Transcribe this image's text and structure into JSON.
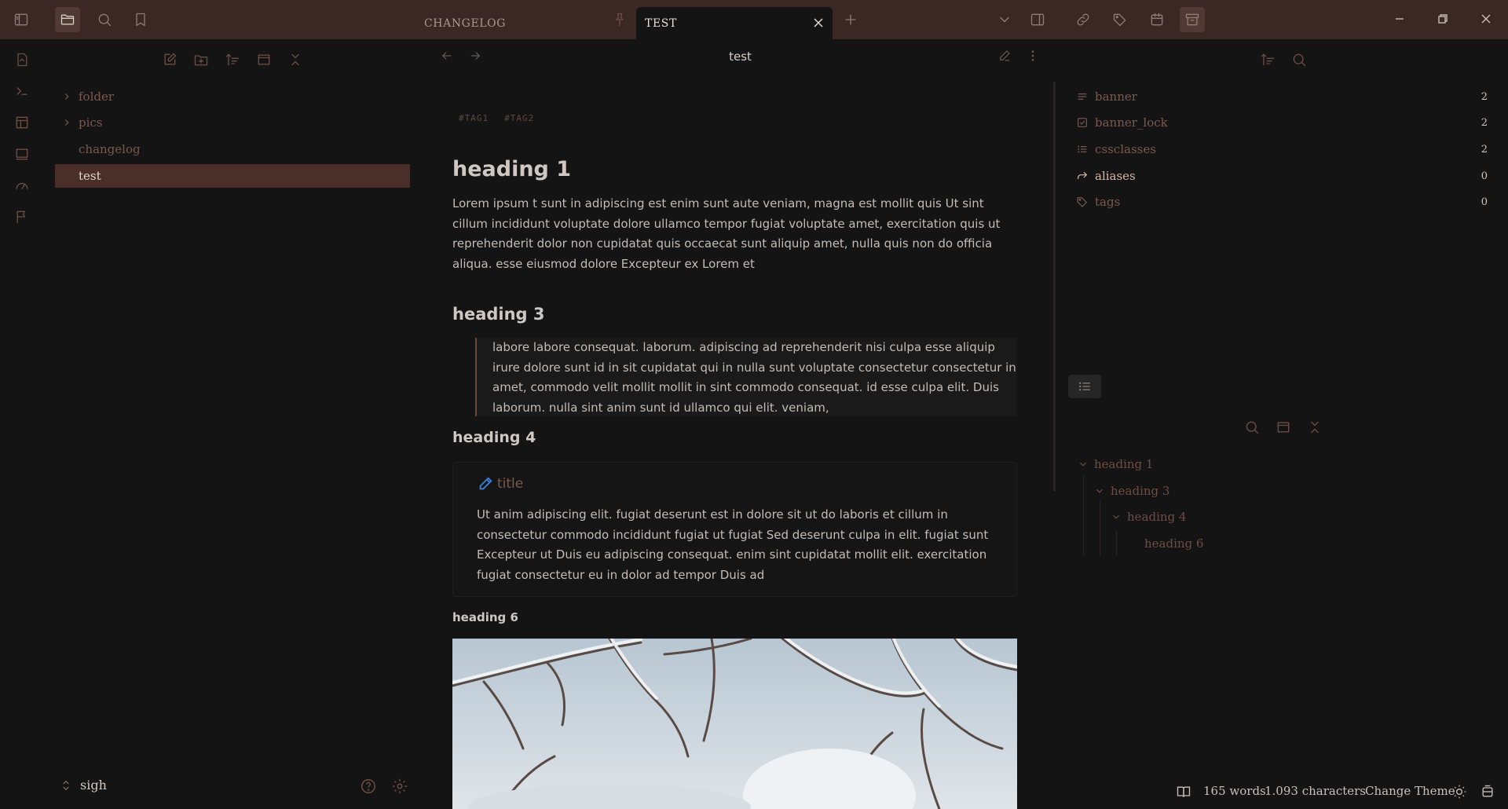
{
  "tabs": [
    {
      "label": "CHANGELOG",
      "active": false
    },
    {
      "label": "TEST",
      "active": true
    }
  ],
  "file_explorer": {
    "items": [
      {
        "label": "folder",
        "type": "folder"
      },
      {
        "label": "pics",
        "type": "folder"
      },
      {
        "label": "changelog",
        "type": "file"
      },
      {
        "label": "test",
        "type": "file",
        "selected": true
      }
    ],
    "vault_name": "sigh"
  },
  "editor": {
    "title": "test",
    "tags": [
      "#TAG1",
      "#TAG2"
    ],
    "heading1": "heading 1",
    "para1": "Lorem ipsum t sunt in adipiscing est enim sunt aute veniam, magna est mollit quis Ut sint cillum incididunt voluptate dolore ullamco tempor fugiat voluptate amet, exercitation quis ut reprehenderit dolor non cupidatat quis occaecat sunt aliquip amet, nulla quis non do officia aliqua. esse eiusmod dolore Excepteur ex Lorem et",
    "heading3": "heading 3",
    "quote": "labore labore consequat. laborum. adipiscing ad reprehenderit nisi culpa esse aliquip irure dolore sunt id in sit cupidatat qui in nulla sunt voluptate consectetur consectetur in amet, commodo velit mollit mollit in sint commodo consequat. id esse culpa elit. Duis laborum. nulla sint anim sunt id ullamco qui elit. veniam,",
    "heading4": "heading 4",
    "callout_title": "title",
    "callout_body": "Ut anim adipiscing elit. fugiat deserunt est in dolore sit ut do laboris et cillum in consectetur commodo incididunt fugiat ut fugiat Sed deserunt culpa in elit. fugiat sunt Excepteur ut Duis eu adipiscing consequat. enim sint cupidatat mollit elit. exercitation fugiat consectetur eu in dolor ad tempor Duis ad",
    "heading6": "heading 6"
  },
  "properties": [
    {
      "name": "banner",
      "icon": "text-icon",
      "count": "2"
    },
    {
      "name": "banner_lock",
      "icon": "checkbox-icon",
      "count": "2"
    },
    {
      "name": "cssclasses",
      "icon": "list-icon",
      "count": "2"
    },
    {
      "name": "aliases",
      "icon": "forward-icon",
      "count": "0"
    },
    {
      "name": "tags",
      "icon": "tags-icon",
      "count": "0"
    }
  ],
  "outline": [
    {
      "label": "heading 1",
      "level": 1,
      "collapsible": true
    },
    {
      "label": "heading 3",
      "level": 2,
      "collapsible": true
    },
    {
      "label": "heading 4",
      "level": 3,
      "collapsible": true
    },
    {
      "label": "heading 6",
      "level": 4,
      "collapsible": false
    }
  ],
  "status_bar": {
    "words": "165 words",
    "characters": "1.093 characters",
    "theme": "Change Theme"
  },
  "colors": {
    "titlebar": "#3b2824",
    "accent": "#6e4e44",
    "selected": "#4a2f29",
    "background": "#141414",
    "callout_icon": "#3b7dd8"
  }
}
